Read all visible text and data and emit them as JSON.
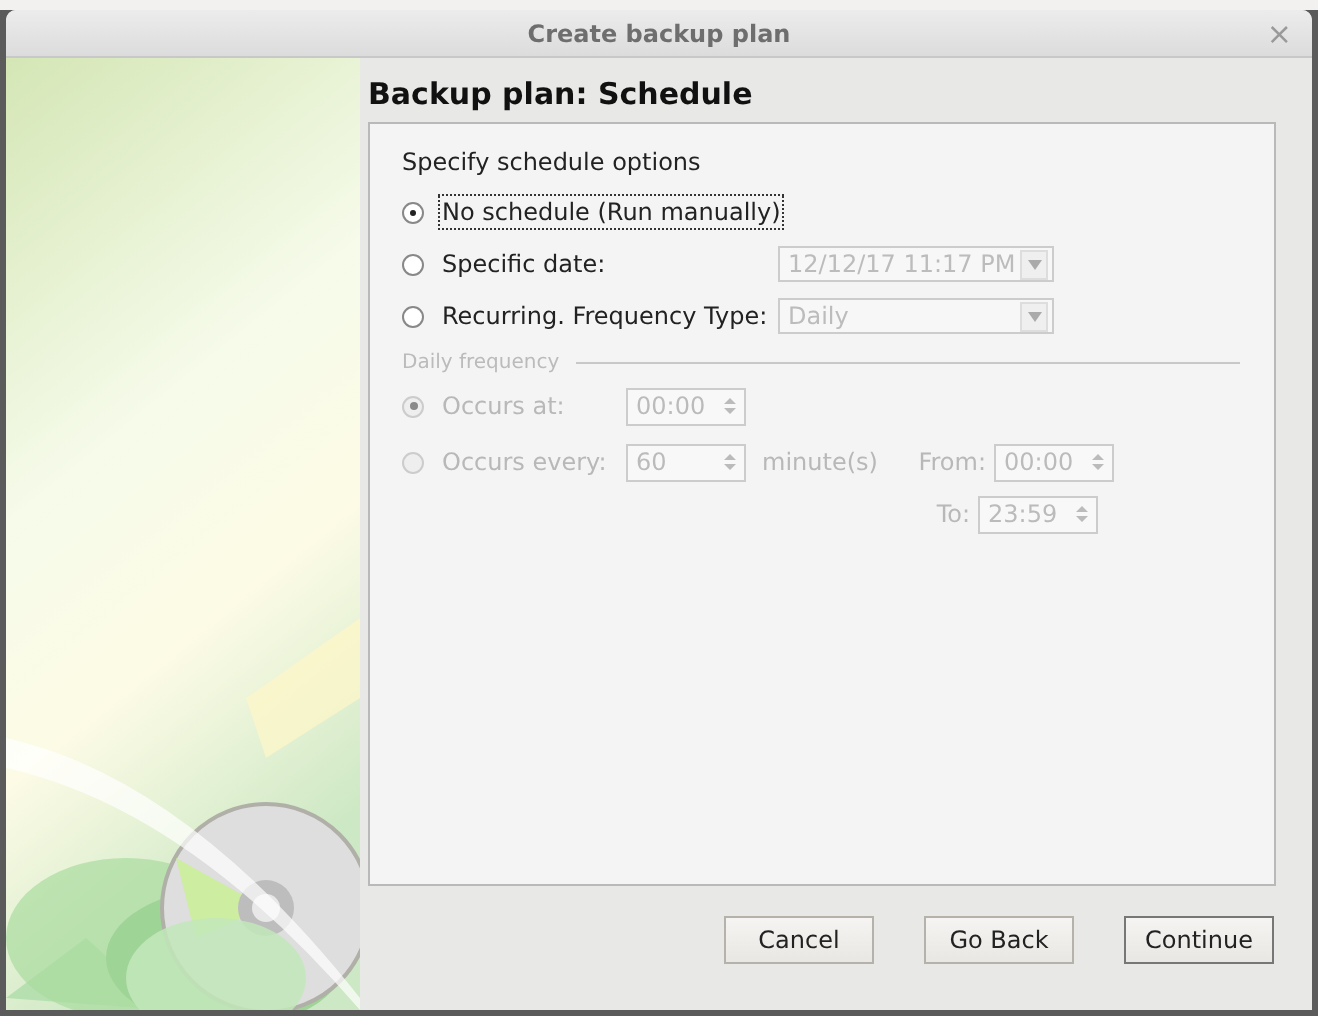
{
  "window": {
    "title": "Create backup plan",
    "close": "×"
  },
  "page_title": "Backup plan: Schedule",
  "section_label": "Specify schedule options",
  "options": [
    {
      "label": "No schedule (Run manually)",
      "selected": true,
      "disabled": false,
      "focused": true
    },
    {
      "label": "Specific date:",
      "selected": false,
      "disabled": false,
      "focused": false,
      "field": {
        "kind": "combo",
        "value": "12/12/17 11:17 PM",
        "disabled": true
      }
    },
    {
      "label": "Recurring. Frequency Type:",
      "selected": false,
      "disabled": false,
      "focused": false,
      "field": {
        "kind": "combo",
        "value": "Daily",
        "disabled": true
      }
    }
  ],
  "daily_frequency": {
    "label": "Daily frequency",
    "options": [
      {
        "label": "Occurs at:",
        "selected": true,
        "disabled": true,
        "value": "00:00"
      },
      {
        "label": "Occurs every:",
        "selected": false,
        "disabled": true,
        "value": "60",
        "unit": "minute(s)",
        "from_label": "From:",
        "from_value": "00:00",
        "to_label": "To:",
        "to_value": "23:59"
      }
    ]
  },
  "buttons": [
    {
      "label": "Cancel",
      "default": false
    },
    {
      "label": "Go Back",
      "default": false
    },
    {
      "label": "Continue",
      "default": true
    }
  ]
}
